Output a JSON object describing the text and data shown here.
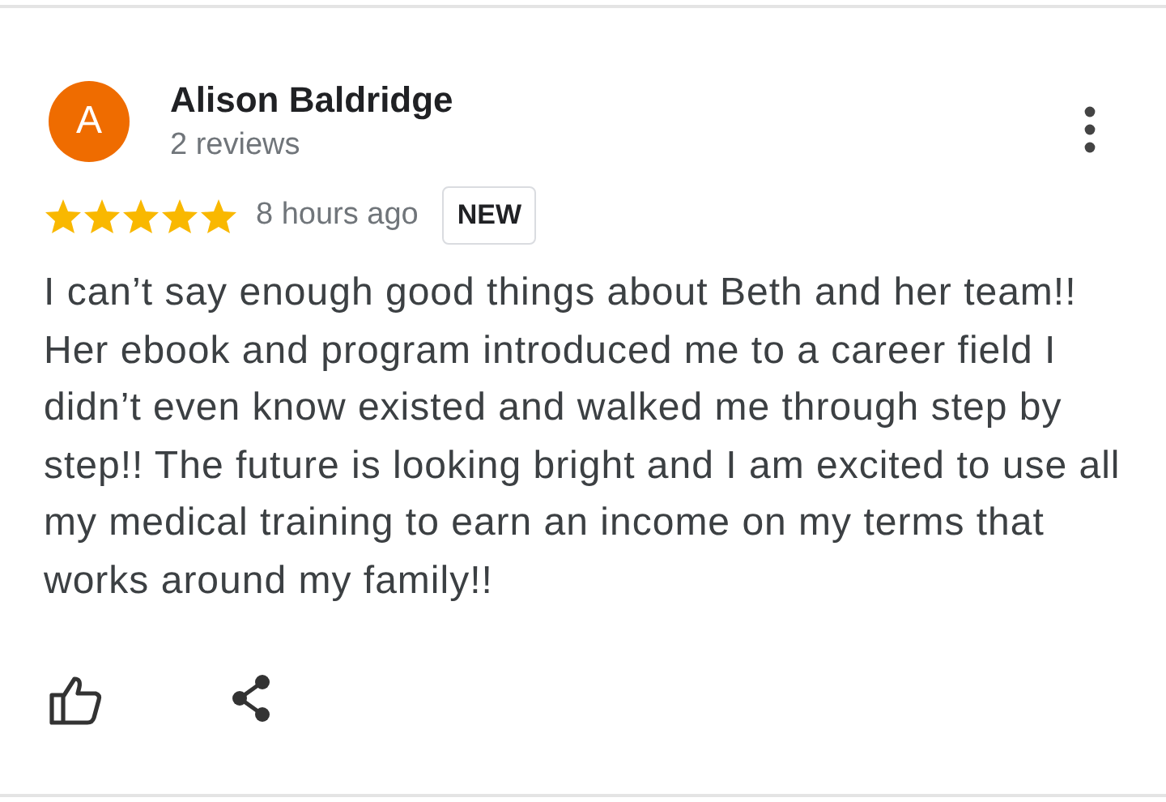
{
  "review": {
    "avatar_letter": "A",
    "author": "Alison Baldridge",
    "author_meta": "2 reviews",
    "stars": 5,
    "time": "8 hours ago",
    "badge": "NEW",
    "text": "I can’t say enough good things about Beth and her team!! Her ebook and program introduced me to a career field I didn’t even know existed and walked me through step by step!! The future is looking bright and I am excited to use all my medical training to earn an income on my terms that works around my family!!"
  }
}
